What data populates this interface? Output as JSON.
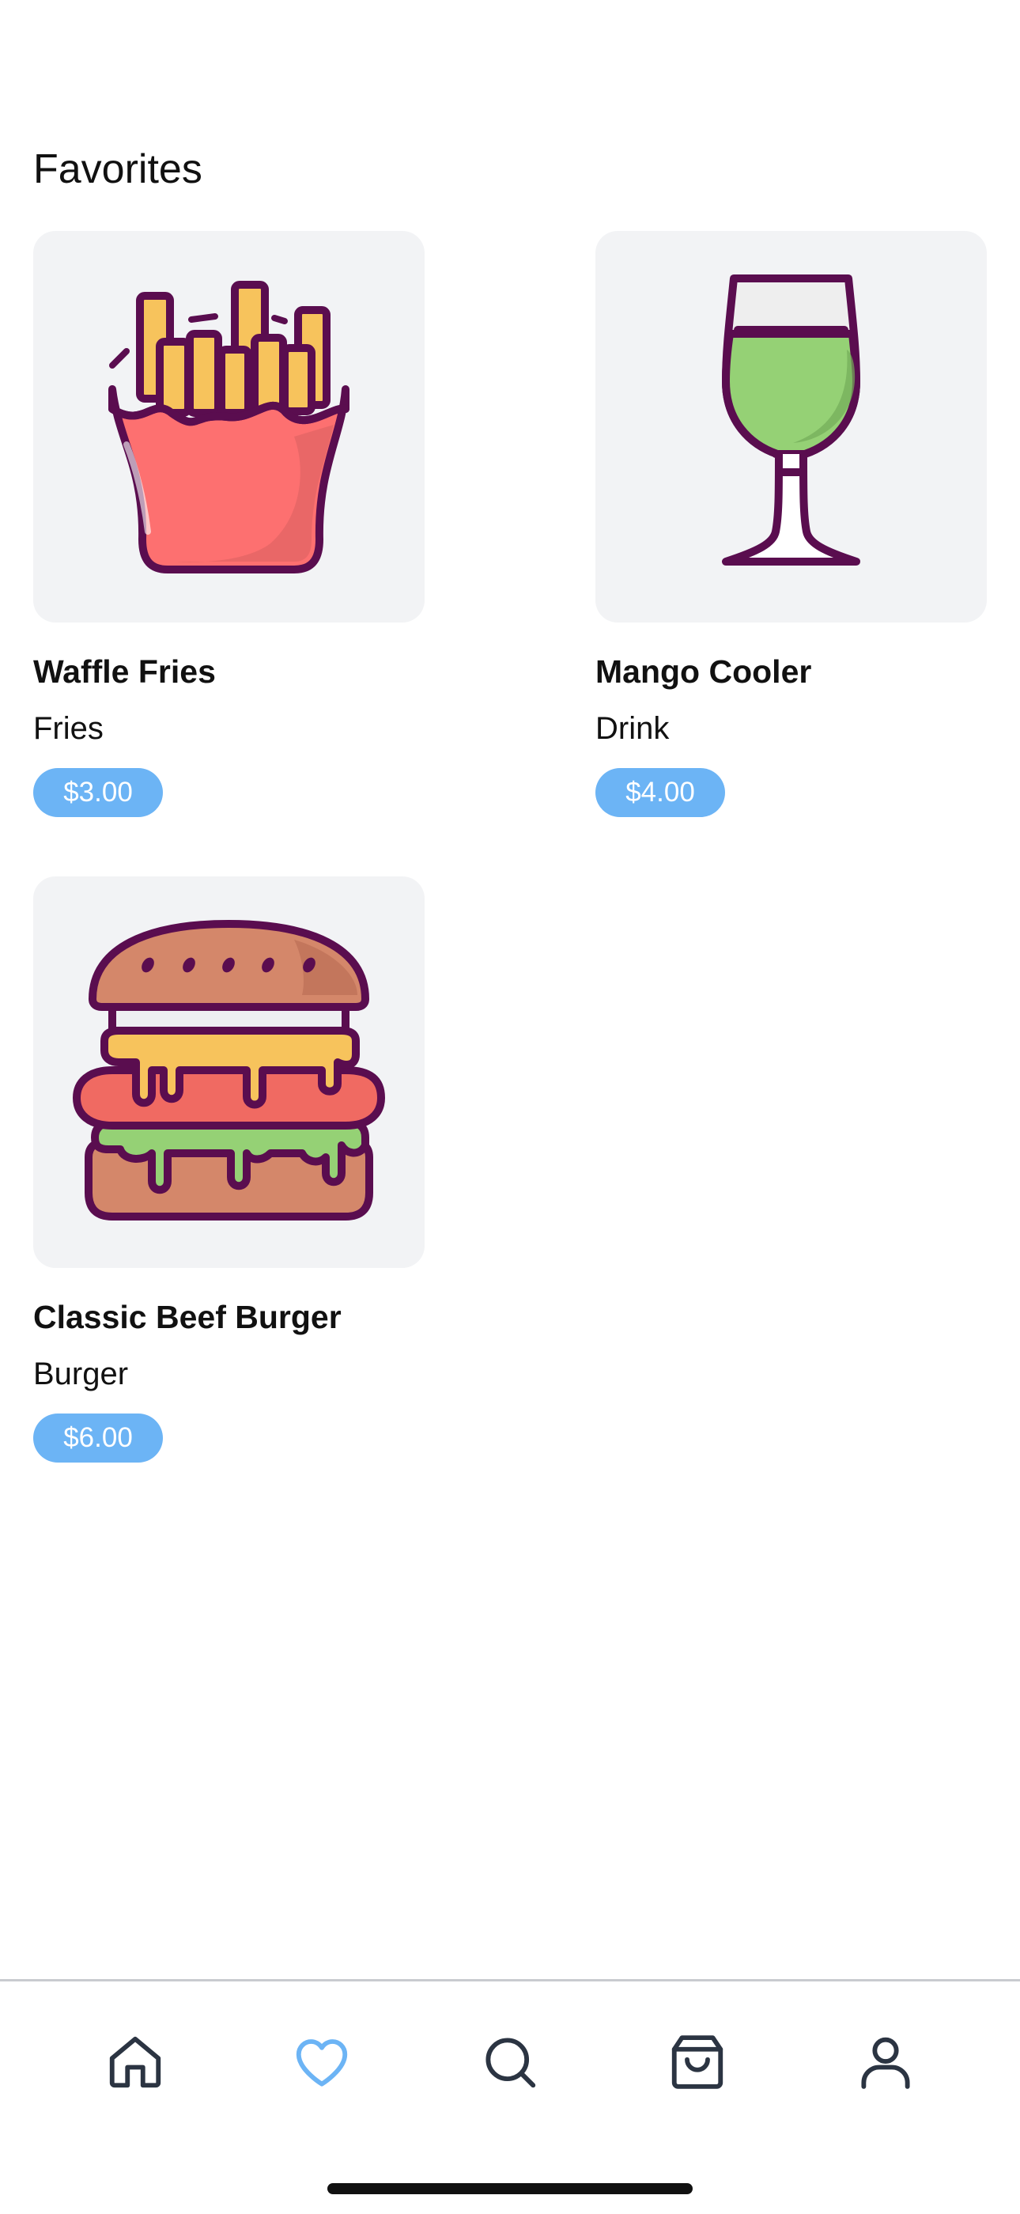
{
  "header": {
    "title": "Favorites"
  },
  "favorites": [
    {
      "name": "Waffle Fries",
      "category": "Fries",
      "price": "$3.00",
      "icon": "fries-icon"
    },
    {
      "name": "Mango Cooler",
      "category": "Drink",
      "price": "$4.00",
      "icon": "drink-glass-icon"
    },
    {
      "name": "Classic Beef Burger",
      "category": "Burger",
      "price": "$6.00",
      "icon": "burger-icon"
    }
  ],
  "tabbar": {
    "items": [
      {
        "icon": "home-icon",
        "active": false
      },
      {
        "icon": "heart-icon",
        "active": true
      },
      {
        "icon": "search-icon",
        "active": false
      },
      {
        "icon": "shopping-bag-icon",
        "active": false
      },
      {
        "icon": "user-icon",
        "active": false
      }
    ]
  },
  "colors": {
    "accent": "#6cb4f5",
    "tab_inactive": "#2b3442",
    "card_bg": "#f2f3f5",
    "outline": "#5a0d4f"
  }
}
